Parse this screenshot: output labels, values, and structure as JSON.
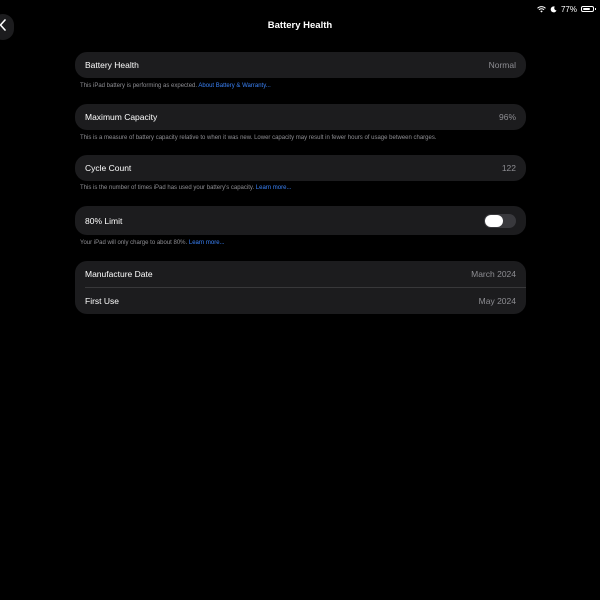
{
  "status_bar": {
    "battery_percent": "77%",
    "battery_level": 0.77,
    "icons": [
      "wifi-icon",
      "moon-icon",
      "battery-icon"
    ]
  },
  "nav": {
    "title": "Battery Health",
    "back_icon": "chevron-left-icon"
  },
  "battery_health": {
    "label": "Battery Health",
    "value": "Normal",
    "footnote": "This iPad battery is performing as expected.",
    "footnote_link": "About Battery & Warranty..."
  },
  "maximum_capacity": {
    "label": "Maximum Capacity",
    "value": "96%",
    "footnote": "This is a measure of battery capacity relative to when it was new. Lower capacity may result in fewer hours of usage between charges."
  },
  "cycle_count": {
    "label": "Cycle Count",
    "value": "122",
    "footnote": "This is the number of times iPad has used your battery's capacity.",
    "footnote_link": "Learn more..."
  },
  "limit": {
    "label": "80% Limit",
    "enabled": false,
    "footnote": "Your iPad will only charge to about 80%.",
    "footnote_link": "Learn more..."
  },
  "dates": {
    "manufacture_label": "Manufacture Date",
    "manufacture_value": "March 2024",
    "first_use_label": "First Use",
    "first_use_value": "May 2024"
  },
  "colors": {
    "background": "#000000",
    "card": "#1c1c1e",
    "secondary_text": "#8e8e93",
    "link": "#3a82f7"
  }
}
